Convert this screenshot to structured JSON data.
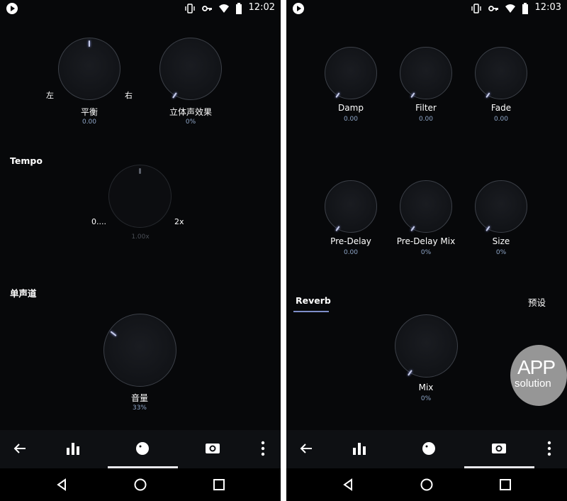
{
  "left_screen": {
    "status": {
      "time": "12:02"
    },
    "balance": {
      "left_label": "左",
      "right_label": "右",
      "label": "平衡",
      "value": "0.00"
    },
    "stereo": {
      "label": "立体声效果",
      "value": "0%"
    },
    "tempo": {
      "section": "Tempo",
      "min_label": "0....",
      "max_label": "2x",
      "value": "1.00x"
    },
    "mono": {
      "section": "单声道"
    },
    "volume": {
      "label": "音量",
      "value": "33%"
    }
  },
  "right_screen": {
    "status": {
      "time": "12:03"
    },
    "knobs": [
      {
        "label": "Damp",
        "value": "0.00"
      },
      {
        "label": "Filter",
        "value": "0.00"
      },
      {
        "label": "Fade",
        "value": "0.00"
      },
      {
        "label": "Pre-Delay",
        "value": "0.00"
      },
      {
        "label": "Pre-Delay Mix",
        "value": "0%"
      },
      {
        "label": "Size",
        "value": "0%"
      }
    ],
    "tab": {
      "active": "Reverb",
      "preset": "预设"
    },
    "mix": {
      "label": "Mix",
      "value": "0%"
    }
  },
  "watermark": {
    "line1": "APP",
    "line2": "solution"
  },
  "icons": [
    "play-circle-icon",
    "vibrate-icon",
    "key-icon",
    "wifi-icon",
    "battery-icon",
    "back-arrow-icon",
    "equalizer-icon",
    "knob-icon",
    "surround-icon",
    "more-vert-icon",
    "nav-back-icon",
    "nav-home-icon",
    "nav-recents-icon"
  ],
  "colors": {
    "background": "#07080a",
    "accent": "#7e8ec9",
    "value_text": "#8fa6c8"
  }
}
